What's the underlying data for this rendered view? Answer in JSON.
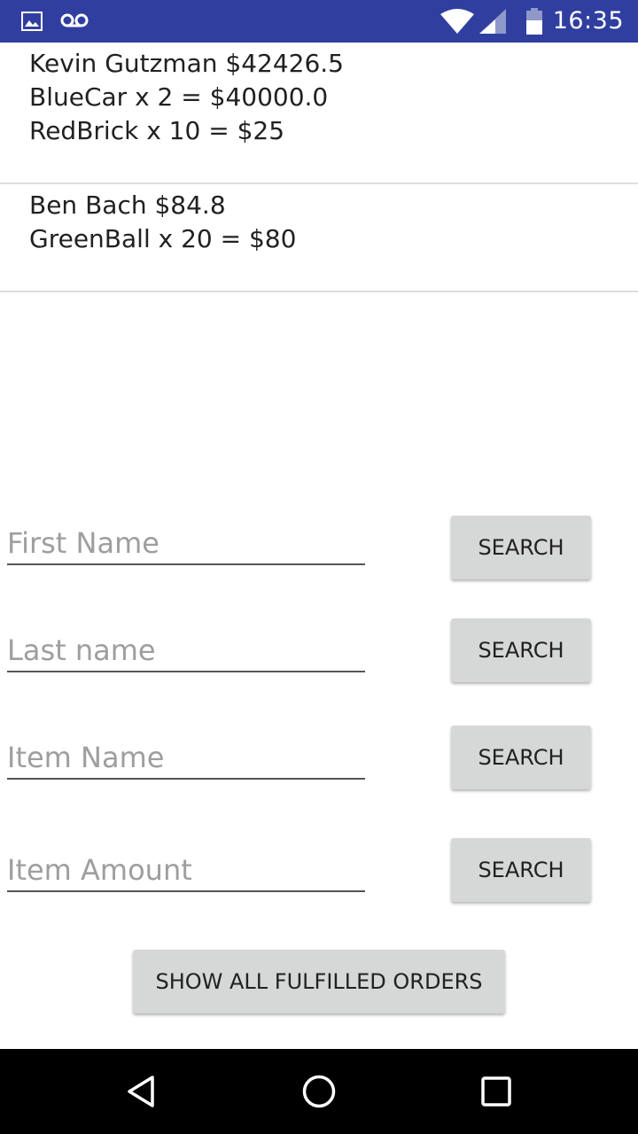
{
  "status_bar": {
    "time": "16:35",
    "icons": [
      "image-notification-icon",
      "voicemail-icon",
      "wifi-icon",
      "cell-signal-icon",
      "battery-icon"
    ],
    "background": "#303f9f"
  },
  "orders": [
    {
      "header": "Kevin Gutzman $42426.5",
      "lines": [
        "BlueCar x 2 = $40000.0",
        "RedBrick x 10 = $25"
      ]
    },
    {
      "header": "Ben Bach $84.8",
      "lines": [
        "GreenBall x 20 = $80"
      ]
    }
  ],
  "search": {
    "first_name": {
      "placeholder": "First Name",
      "value": "",
      "button": "SEARCH"
    },
    "last_name": {
      "placeholder": "Last name",
      "value": "",
      "button": "SEARCH"
    },
    "item_name": {
      "placeholder": "Item Name",
      "value": "",
      "button": "SEARCH"
    },
    "item_amount": {
      "placeholder": "Item Amount",
      "value": "",
      "button": "SEARCH"
    }
  },
  "show_all_button": "SHOW ALL FULFILLED ORDERS",
  "nav_bar": {
    "buttons": [
      "back-icon",
      "home-icon",
      "recents-icon"
    ]
  }
}
